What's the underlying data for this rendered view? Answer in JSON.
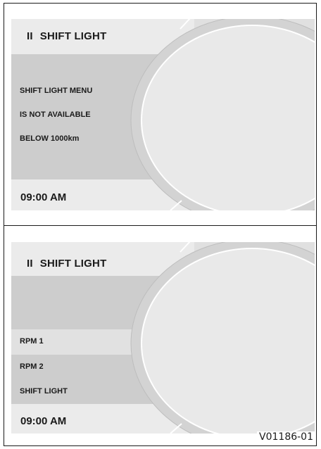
{
  "screens": [
    {
      "title_prefix": "II",
      "title": "SHIFT LIGHT",
      "message_lines": [
        "SHIFT LIGHT MENU",
        "IS NOT AVAILABLE",
        "BELOW 1000km"
      ],
      "clock": "09:00 AM"
    },
    {
      "title_prefix": "II",
      "title": "SHIFT LIGHT",
      "menu_items": [
        "RPM 1",
        "RPM 2",
        "SHIFT LIGHT"
      ],
      "clock": "09:00 AM"
    }
  ],
  "figure_code": "V01186-01",
  "colors": {
    "panel_light": "#ebebeb",
    "panel_dark": "#cdcdcd",
    "oval_fill": "#e9e9e9",
    "ring": "#d0d0d0",
    "frame": "#1a1a1a"
  }
}
